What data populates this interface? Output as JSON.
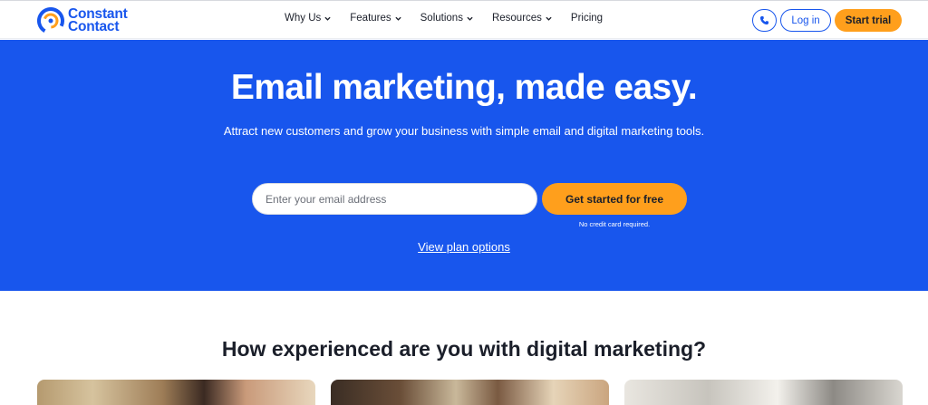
{
  "header": {
    "logo_line1": "Constant",
    "logo_line2": "Contact",
    "nav": [
      {
        "label": "Why Us",
        "dropdown": true
      },
      {
        "label": "Features",
        "dropdown": true
      },
      {
        "label": "Solutions",
        "dropdown": true
      },
      {
        "label": "Resources",
        "dropdown": true
      },
      {
        "label": "Pricing",
        "dropdown": false
      }
    ],
    "login_label": "Log in",
    "trial_label": "Start trial",
    "phone_icon": "phone-icon"
  },
  "hero": {
    "title": "Email marketing, made easy.",
    "subtitle": "Attract new customers and grow your business with simple email and digital marketing tools.",
    "email_placeholder": "Enter your email address",
    "cta_label": "Get started for free",
    "no_card_note": "No credit card required.",
    "plan_link": "View plan options"
  },
  "section": {
    "title": "How experienced are you with digital marketing?"
  },
  "colors": {
    "brand_blue": "#1856ed",
    "accent_orange": "#ff9f1c"
  }
}
